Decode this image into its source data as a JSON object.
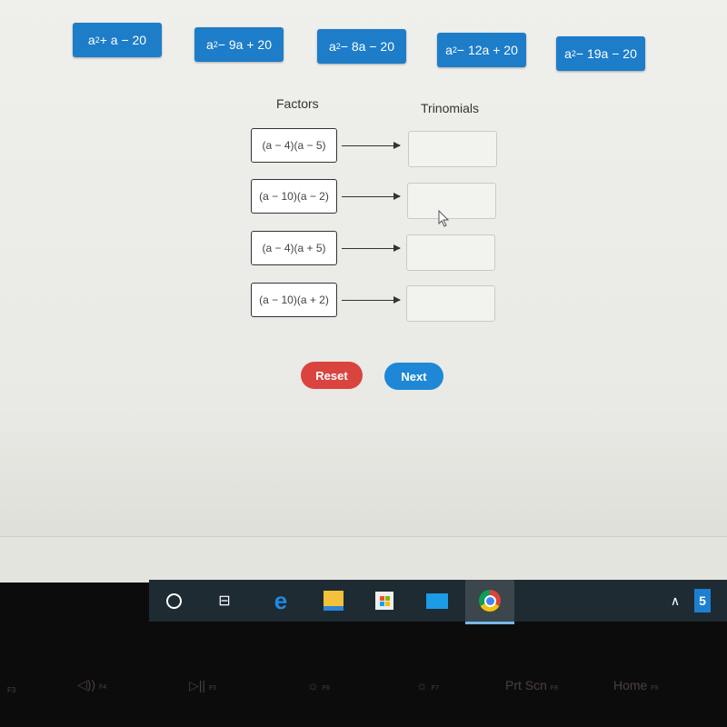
{
  "trinomial_tiles": [
    {
      "base": "a",
      "exp": "2",
      "rest": " + a − 20"
    },
    {
      "base": "a",
      "exp": "2",
      "rest": " − 9a + 20"
    },
    {
      "base": "a",
      "exp": "2",
      "rest": " − 8a − 20"
    },
    {
      "base": "a",
      "exp": "2",
      "rest": " − 12a + 20"
    },
    {
      "base": "a",
      "exp": "2",
      "rest": " − 19a − 20"
    }
  ],
  "headings": {
    "factors": "Factors",
    "trinomials": "Trinomials"
  },
  "factors": [
    "(a − 4)(a − 5)",
    "(a − 10)(a − 2)",
    "(a − 4)(a + 5)",
    "(a − 10)(a + 2)"
  ],
  "buttons": {
    "reset": "Reset",
    "next": "Next"
  },
  "colors": {
    "tile": "#1d7dc9",
    "reset": "#d9443f",
    "next": "#1e88d6",
    "taskbar": "#1e2b33"
  },
  "taskbar": {
    "icons": [
      "cortana-icon",
      "task-view-icon",
      "edge-icon",
      "file-explorer-icon",
      "store-icon",
      "mail-icon",
      "chrome-icon"
    ],
    "tray_badge": "5"
  },
  "keyboard": {
    "keys": [
      {
        "label": "F3",
        "fn": ""
      },
      {
        "label": "◁))",
        "fn": "F4"
      },
      {
        "label": "▷||",
        "fn": "F5"
      },
      {
        "label": "☼",
        "fn": "F6"
      },
      {
        "label": "☼",
        "fn": "F7"
      },
      {
        "label": "Prt Scn",
        "fn": "F8"
      },
      {
        "label": "Home",
        "fn": "F9"
      }
    ]
  }
}
